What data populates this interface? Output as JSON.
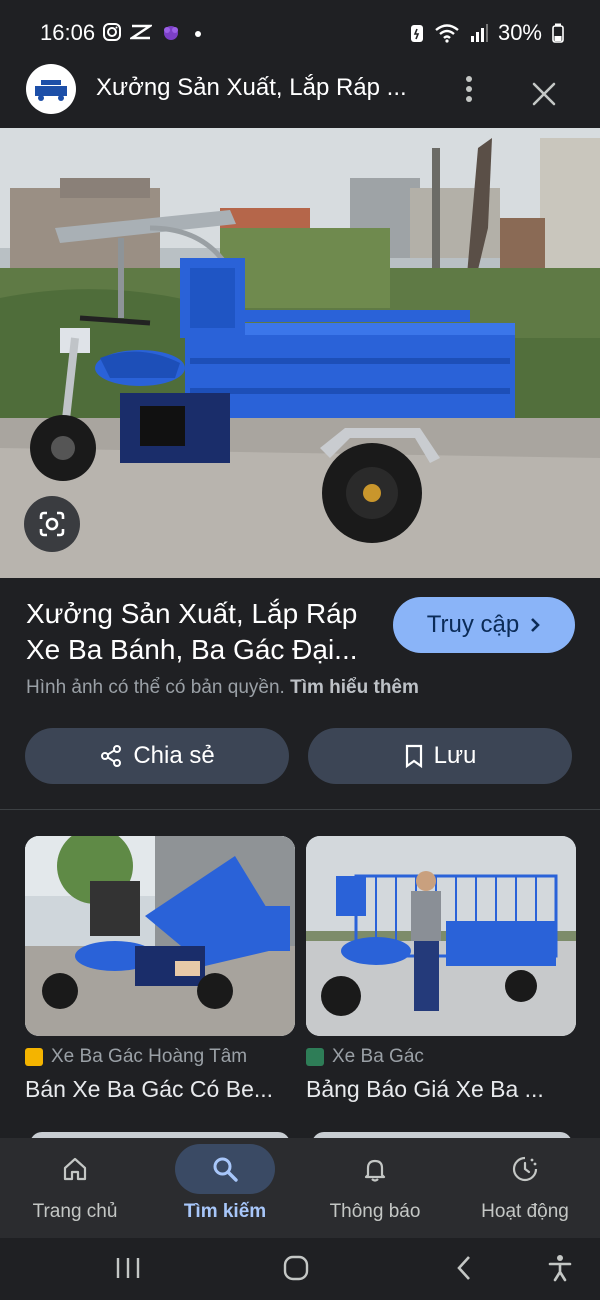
{
  "status_bar": {
    "time": "16:06",
    "battery": "30%"
  },
  "header": {
    "title": "Xưởng Sản Xuất, Lắp Ráp ..."
  },
  "result": {
    "title": "Xưởng Sản Xuất, Lắp Ráp Xe Ba Bánh, Ba Gác Đại...",
    "visit_label": "Truy cập",
    "copyright_text": "Hình ảnh có thể có bản quyền.",
    "learn_more": "Tìm hiểu thêm",
    "share_label": "Chia sẻ",
    "save_label": "Lưu"
  },
  "related": [
    {
      "source": "Xe Ba Gác Hoàng Tâm",
      "title": "Bán Xe Ba Gác Có Be..."
    },
    {
      "source": "Xe Ba Gác",
      "title": "Bảng Báo Giá Xe Ba ..."
    }
  ],
  "bottom_nav": [
    {
      "label": "Trang chủ",
      "icon": "home-icon",
      "active": false
    },
    {
      "label": "Tìm kiếm",
      "icon": "search-icon",
      "active": true
    },
    {
      "label": "Thông báo",
      "icon": "bell-icon",
      "active": false
    },
    {
      "label": "Hoạt động",
      "icon": "activity-icon",
      "active": false
    }
  ],
  "colors": {
    "background": "#1f2023",
    "accent": "#8ab4f8",
    "truck_blue": "#2a62d8"
  }
}
